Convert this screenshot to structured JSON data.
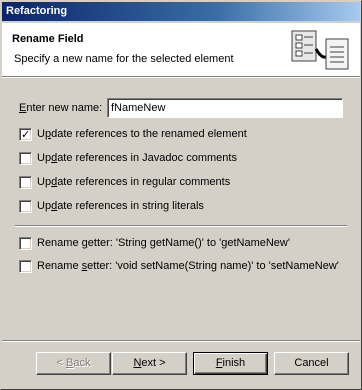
{
  "window": {
    "title": "Refactoring"
  },
  "header": {
    "title": "Rename Field",
    "description": "Specify a new name for the selected element",
    "icon": "refactoring-wizard-icon"
  },
  "form": {
    "new_name_label_underlined": "E",
    "new_name_label_rest": "nter new name:",
    "new_name_value": "fNameNew"
  },
  "options": [
    {
      "prefix": "U",
      "underlined": "p",
      "rest": "date references to the renamed element",
      "checked": true
    },
    {
      "prefix": "Up",
      "underlined": "d",
      "rest": "ate references in Javadoc comments",
      "checked": false
    },
    {
      "prefix": "Up",
      "underlined": "d",
      "rest": "ate references in regular comments",
      "checked": false
    },
    {
      "prefix": "Up",
      "underlined": "d",
      "rest": "ate references in string literals",
      "checked": false
    }
  ],
  "accessors": [
    {
      "prefix": "Rename ",
      "underlined": "g",
      "rest": "etter: 'String getName()' to 'getNameNew'",
      "checked": false
    },
    {
      "prefix": "Rename ",
      "underlined": "s",
      "rest": "etter: 'void setName(String name)' to 'setNameNew'",
      "checked": false
    }
  ],
  "buttons": {
    "back_lt": "< ",
    "back_underlined": "B",
    "back_rest": "ack",
    "next_underlined": "N",
    "next_rest": "ext >",
    "finish_underlined": "F",
    "finish_rest": "inish",
    "cancel": "Cancel"
  }
}
